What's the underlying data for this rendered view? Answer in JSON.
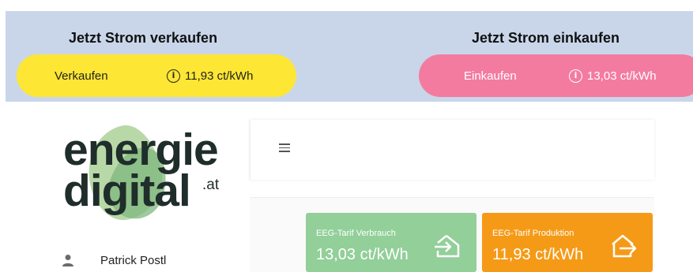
{
  "banner": {
    "sell_title": "Jetzt Strom verkaufen",
    "buy_title": "Jetzt Strom einkaufen",
    "sell": {
      "label": "Verkaufen",
      "price": "11,93 ct/kWh",
      "color": "#fde634"
    },
    "buy": {
      "label": "Einkaufen",
      "price": "13,03 ct/kWh",
      "color": "#f47ba0"
    }
  },
  "logo": {
    "line1": "energie",
    "line2": "digital",
    "suffix": ".at"
  },
  "user": {
    "name": "Patrick Postl"
  },
  "tiles": [
    {
      "label": "EEG-Tarif Verbrauch",
      "value": "13,03 ct/kWh",
      "color": "#92cf99",
      "icon": "house-arrow-in-icon"
    },
    {
      "label": "EEG-Tarif Produktion",
      "value": "11,93 ct/kWh",
      "color": "#f59a17",
      "icon": "house-arrow-out-icon"
    }
  ]
}
